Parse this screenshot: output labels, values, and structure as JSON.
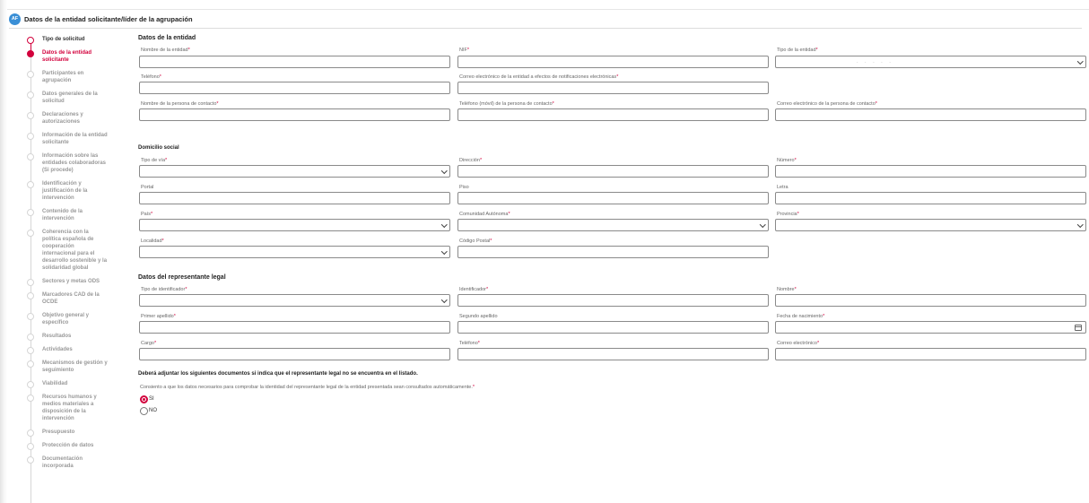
{
  "header": {
    "badge": "AF",
    "title": "Datos de la entidad solicitante/líder de la agrupación"
  },
  "steps": [
    {
      "label": "Tipo de solicitud",
      "state": "done"
    },
    {
      "label": "Datos de la entidad solicitante",
      "state": "active"
    },
    {
      "label": "Participantes en agrupación",
      "state": "pending"
    },
    {
      "label": "Datos generales de la solicitud",
      "state": "pending"
    },
    {
      "label": "Declaraciones y autorizaciones",
      "state": "pending"
    },
    {
      "label": "Información de la entidad solicitante",
      "state": "pending"
    },
    {
      "label": "Información sobre las entidades colaboradoras (Si procede)",
      "state": "pending"
    },
    {
      "label": "Identificación y justificación de la intervención",
      "state": "pending"
    },
    {
      "label": "Contenido de la intervención",
      "state": "pending"
    },
    {
      "label": "Coherencia con la política española de cooperación internacional para el desarrollo sostenible y la solidaridad global",
      "state": "pending"
    },
    {
      "label": "Sectores y metas ODS",
      "state": "pending"
    },
    {
      "label": "Marcadores CAD de la OCDE",
      "state": "pending"
    },
    {
      "label": "Objetivo general y específico",
      "state": "pending"
    },
    {
      "label": "Resultados",
      "state": "pending"
    },
    {
      "label": "Actividades",
      "state": "pending"
    },
    {
      "label": "Mecanismos de gestión y seguimiento",
      "state": "pending"
    },
    {
      "label": "Viabilidad",
      "state": "pending"
    },
    {
      "label": "Recursos humanos y medios materiales a disposición de la intervención",
      "state": "pending"
    },
    {
      "label": "Presupuesto",
      "state": "pending"
    },
    {
      "label": "Protección de datos",
      "state": "pending"
    },
    {
      "label": "Documentación incorporada",
      "state": "pending"
    }
  ],
  "entidad": {
    "title": "Datos de la entidad",
    "nombre": "Nombre de la entidad",
    "nif": "NIF",
    "tipo": "Tipo de la entidad",
    "telefono": "Teléfono",
    "correo": "Correo electrónico de la entidad a efectos de notificaciones electrónicas",
    "contacto": "Nombre de la persona de contacto",
    "tel_contacto": "Teléfono (móvil) de la persona de contacto",
    "correo_contacto": "Correo electrónico de la persona de contacto"
  },
  "domicilio": {
    "title": "Domicilio social",
    "tipo_via": "Tipo de vía",
    "direccion": "Dirección",
    "numero": "Número",
    "portal": "Portal",
    "piso": "Piso",
    "letra": "Letra",
    "pais": "País",
    "comunidad": "Comunidad Autónoma",
    "provincia": "Provincia",
    "localidad": "Localidad",
    "cp": "Código Postal"
  },
  "representante": {
    "title": "Datos del representante legal",
    "tipo_id": "Tipo de identificador",
    "identificador": "Identificador",
    "nombre": "Nombre",
    "apellido1": "Primer apellido",
    "apellido2": "Segundo apellido",
    "fecha": "Fecha de nacimiento",
    "cargo": "Cargo",
    "telefono": "Teléfono",
    "correo": "Correo electrónico"
  },
  "note": "Deberá adjuntar los siguientes documentos si indica que el representante legal no se encuentra en el listado.",
  "consent": "Consiento a que los datos necesarios para comprobar la identidad del representante legal de la entidad presentada sean consultados automáticamente.",
  "radio": {
    "si": "SI",
    "no": "NO",
    "selected": "si"
  },
  "colors": {
    "accent": "#d2003c",
    "badge": "#3a8fd6"
  }
}
